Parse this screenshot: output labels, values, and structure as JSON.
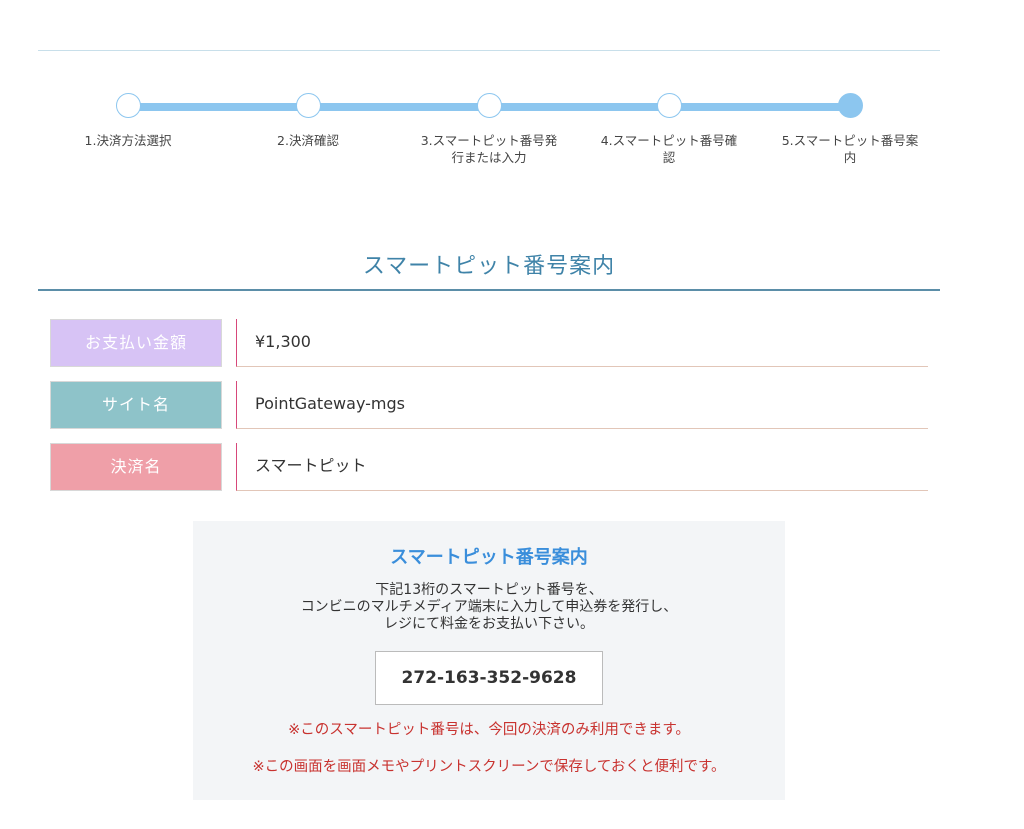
{
  "stepper": {
    "steps": [
      {
        "label": "1.決済方法選択",
        "active": false
      },
      {
        "label": "2.決済確認",
        "active": false
      },
      {
        "label": "3.スマートピット番号発行または入力",
        "active": false
      },
      {
        "label": "4.スマートピット番号確認",
        "active": false
      },
      {
        "label": "5.スマートピット番号案内",
        "active": true
      }
    ]
  },
  "page": {
    "title": "スマートピット番号案内"
  },
  "info": {
    "rows": [
      {
        "label": "お支払い金額",
        "value": "¥1,300",
        "color": "#d7c3f5"
      },
      {
        "label": "サイト名",
        "value": "PointGateway-mgs",
        "color": "#8ec3c9"
      },
      {
        "label": "決済名",
        "value": "スマートピット",
        "color": "#ef9fa8"
      }
    ]
  },
  "guide": {
    "title": "スマートピット番号案内",
    "desc_line1": "下記13桁のスマートピット番号を、",
    "desc_line2": "コンビニのマルチメディア端末に入力して申込券を発行し、",
    "desc_line3": "レジにて料金をお支払い下さい。",
    "number": "272-163-352-9628",
    "note1": "※このスマートピット番号は、今回の決済のみ利用できます。",
    "note2": "※この画面を画面メモやプリントスクリーンで保存しておくと便利です。"
  },
  "colors": {
    "accent": "#3f83a8",
    "stepper": "#8cc6ef",
    "warning": "#c8322f",
    "guide_title": "#3a8edb"
  }
}
